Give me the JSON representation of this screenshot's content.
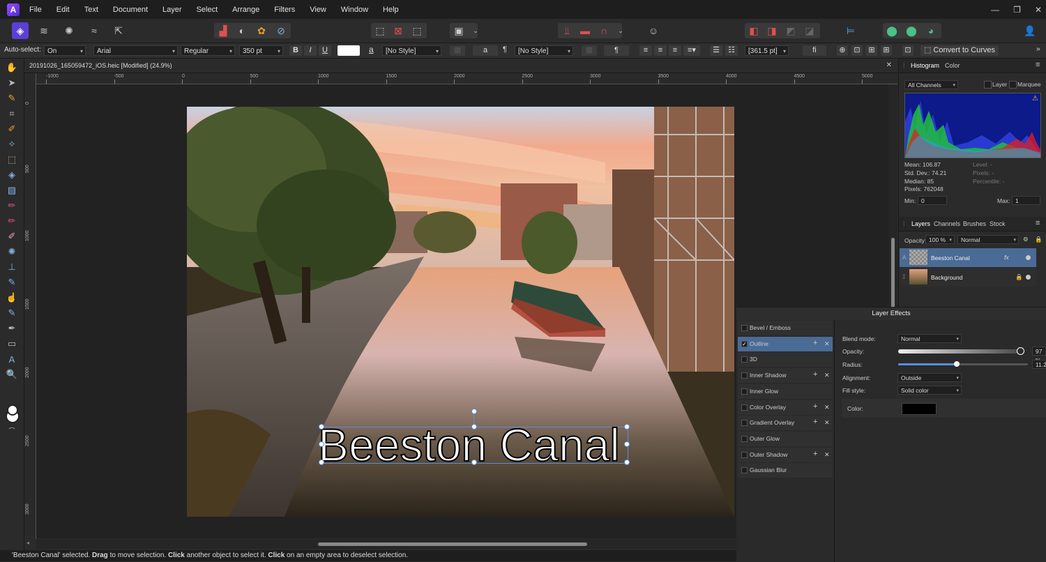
{
  "menu": [
    "File",
    "Edit",
    "Text",
    "Document",
    "Layer",
    "Select",
    "Arrange",
    "Filters",
    "View",
    "Window",
    "Help"
  ],
  "window_controls": {
    "minimize": "—",
    "restore": "❐",
    "close": "✕"
  },
  "context": {
    "auto_select_label": "Auto-select:",
    "auto_select_value": "On",
    "font_family": "Arial",
    "font_style": "Regular",
    "font_size": "350 pt",
    "bold": "B",
    "italic": "I",
    "underline": "U",
    "char_style_glyph": "a",
    "char_style": "[No Style]",
    "char_a": "a",
    "para_glyph": "¶",
    "para_style": "[No Style]",
    "para_btn": "¶",
    "leading": "[361.5 pt]",
    "ligature": "fi",
    "convert_curves": "Convert to Curves"
  },
  "document": {
    "tab_title": "20191026_165059472_iOS.heic [Modified] (24.9%)",
    "close": "✕",
    "units": "px"
  },
  "hruler_labels": [
    "-1000",
    "-500",
    "0",
    "500",
    "1000",
    "1500",
    "2000",
    "2500",
    "3000",
    "3500",
    "4000",
    "4500",
    "5000"
  ],
  "vruler_labels": [
    "0",
    "500",
    "1000",
    "1500",
    "2000",
    "2500",
    "3000"
  ],
  "canvas_text": "Beeston Canal",
  "status": {
    "pre": "'Beeston Canal' selected. ",
    "b1": "Drag",
    "t1": " to move selection. ",
    "b2": "Click",
    "t2": " another object to select it. ",
    "b3": "Click",
    "t3": " on an empty area to deselect selection."
  },
  "histogram": {
    "tabs": [
      "Histogram",
      "Color"
    ],
    "channel": "All Channels",
    "layer": "Layer",
    "marquee": "Marquee",
    "mean": "Mean: 106.87",
    "std": "Std. Dev.: 74.21",
    "median": "Median: 85",
    "pixels": "Pixels: 762048",
    "level": "Level: -",
    "pixels2": "Pixels: -",
    "percentile": "Percentile: -",
    "min_label": "Min:",
    "min_value": "0",
    "max_label": "Max:",
    "max_value": "1"
  },
  "layers_panel": {
    "tabs": [
      "Layers",
      "Channels",
      "Brushes",
      "Stock"
    ],
    "opacity_label": "Opacity:",
    "opacity_value": "100 %",
    "blend": "Normal",
    "layers": [
      {
        "name": "Beeston Canal",
        "badge": "A",
        "fx": "fx"
      },
      {
        "name": "Background"
      }
    ]
  },
  "layer_effects": {
    "title": "Layer Effects",
    "effects": [
      {
        "name": "Bevel / Emboss",
        "checked": false,
        "add": false
      },
      {
        "name": "Outline",
        "checked": true,
        "add": true
      },
      {
        "name": "3D",
        "checked": false,
        "add": false
      },
      {
        "name": "Inner Shadow",
        "checked": false,
        "add": true
      },
      {
        "name": "Inner Glow",
        "checked": false,
        "add": false
      },
      {
        "name": "Color Overlay",
        "checked": false,
        "add": true
      },
      {
        "name": "Gradient Overlay",
        "checked": false,
        "add": true
      },
      {
        "name": "Outer Glow",
        "checked": false,
        "add": false
      },
      {
        "name": "Outer Shadow",
        "checked": false,
        "add": true
      },
      {
        "name": "Gaussian Blur",
        "checked": false,
        "add": false
      }
    ],
    "blend_label": "Blend mode:",
    "blend_value": "Normal",
    "opacity_label": "Opacity:",
    "opacity_value": "97 %",
    "opacity_fraction": 0.97,
    "radius_label": "Radius:",
    "radius_value": "11.2",
    "radius_fraction": 0.45,
    "alignment_label": "Alignment:",
    "alignment_value": "Outside",
    "fill_label": "Fill style:",
    "fill_value": "Solid color",
    "color_label": "Color:",
    "color_value": "#000000"
  },
  "colors": {
    "accent": "#4a6b95",
    "selection": "#5b8fd6",
    "bg": "#2b2b2b"
  }
}
